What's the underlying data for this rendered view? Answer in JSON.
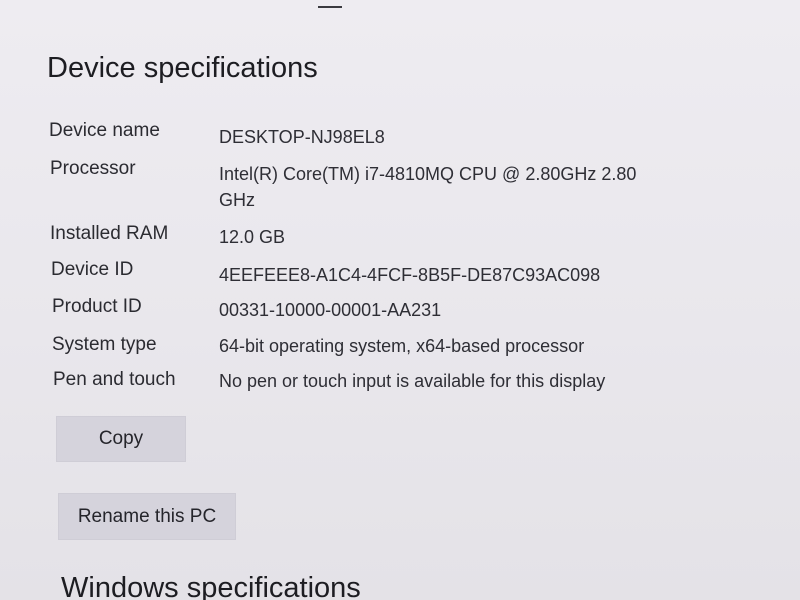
{
  "device_specifications": {
    "heading": "Device specifications",
    "rows": [
      {
        "label": "Device name",
        "value": "DESKTOP-NJ98EL8"
      },
      {
        "label": "Processor",
        "value": "Intel(R) Core(TM) i7-4810MQ CPU @ 2.80GHz   2.80 GHz"
      },
      {
        "label": "Installed RAM",
        "value": "12.0 GB"
      },
      {
        "label": "Device ID",
        "value": "4EEFEEE8-A1C4-4FCF-8B5F-DE87C93AC098"
      },
      {
        "label": "Product ID",
        "value": "00331-10000-00001-AA231"
      },
      {
        "label": "System type",
        "value": "64-bit operating system, x64-based processor"
      },
      {
        "label": "Pen and touch",
        "value": "No pen or touch input is available for this display"
      }
    ],
    "copy_button": "Copy",
    "rename_button": "Rename this PC"
  },
  "windows_specifications": {
    "heading": "Windows specifications"
  }
}
